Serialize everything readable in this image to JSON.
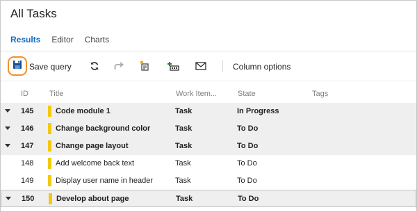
{
  "page": {
    "title": "All Tasks"
  },
  "tabs": [
    {
      "label": "Results",
      "active": true
    },
    {
      "label": "Editor",
      "active": false
    },
    {
      "label": "Charts",
      "active": false
    }
  ],
  "toolbar": {
    "save_label": "Save query",
    "column_options_label": "Column options",
    "highlight_color": "#f3902a",
    "icons": [
      "save-icon",
      "refresh-icon",
      "redo-icon",
      "new-workitem-icon",
      "add-task-icon",
      "email-icon"
    ]
  },
  "grid": {
    "headers": {
      "id": "ID",
      "title": "Title",
      "type": "Work Item...",
      "state": "State",
      "tags": "Tags"
    },
    "type_color": "#f2c811",
    "rows": [
      {
        "id": "145",
        "title": "Code module 1",
        "type": "Task",
        "state": "In Progress",
        "expanded": true,
        "bold": true
      },
      {
        "id": "146",
        "title": "Change background color",
        "type": "Task",
        "state": "To Do",
        "expanded": true,
        "bold": true
      },
      {
        "id": "147",
        "title": "Change page layout",
        "type": "Task",
        "state": "To Do",
        "expanded": true,
        "bold": true
      },
      {
        "id": "148",
        "title": "Add welcome back text",
        "type": "Task",
        "state": "To Do",
        "expanded": false,
        "bold": false
      },
      {
        "id": "149",
        "title": "Display user name in header",
        "type": "Task",
        "state": "To Do",
        "expanded": false,
        "bold": false
      },
      {
        "id": "150",
        "title": "Develop about page",
        "type": "Task",
        "state": "To Do",
        "expanded": true,
        "bold": true,
        "selected": true
      }
    ]
  }
}
